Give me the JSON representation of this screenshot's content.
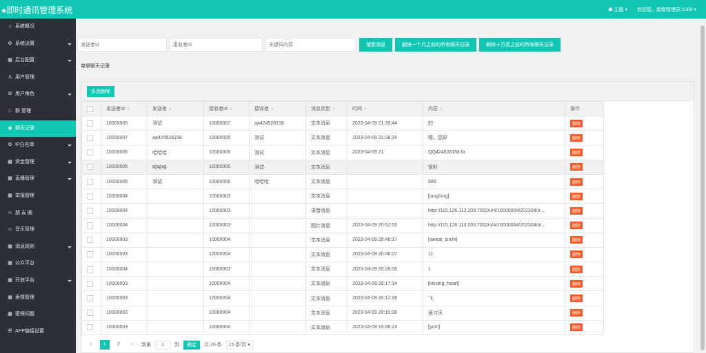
{
  "header": {
    "title": "●即时通讯管理系统",
    "theme_label": "主题",
    "welcome": "欢迎您，超级管理员:1000"
  },
  "sidebar": {
    "items": [
      {
        "label": "系统概况",
        "icon": "home-icon",
        "glyph": "⌂",
        "caret": false,
        "active": false
      },
      {
        "label": "系统设置",
        "icon": "gear-icon",
        "glyph": "⚙",
        "caret": true,
        "active": false
      },
      {
        "label": "后台配置",
        "icon": "calendar-icon",
        "glyph": "▦",
        "caret": true,
        "active": false
      },
      {
        "label": "用户管理",
        "icon": "user-icon",
        "glyph": "♙",
        "caret": false,
        "active": false
      },
      {
        "label": "用户角色",
        "icon": "gear-icon",
        "glyph": "⚙",
        "caret": true,
        "active": false
      },
      {
        "label": "群 管理",
        "icon": "group-icon",
        "glyph": "♘",
        "caret": false,
        "active": false
      },
      {
        "label": "聊天记录",
        "icon": "eye-icon",
        "glyph": "◉",
        "caret": false,
        "active": true
      },
      {
        "label": "IP白名单",
        "icon": "gear-icon",
        "glyph": "⚙",
        "caret": true,
        "active": false
      },
      {
        "label": "资金管理",
        "icon": "calendar-icon",
        "glyph": "▦",
        "caret": true,
        "active": false
      },
      {
        "label": "直播管理",
        "icon": "calendar-icon",
        "glyph": "▦",
        "caret": true,
        "active": false
      },
      {
        "label": "举报管理",
        "icon": "calendar-icon",
        "glyph": "▦",
        "caret": false,
        "active": false
      },
      {
        "label": "朋 友 圈",
        "icon": "smile-icon",
        "glyph": "☺",
        "caret": false,
        "active": false
      },
      {
        "label": "音乐管理",
        "icon": "smile-icon",
        "glyph": "☺",
        "caret": false,
        "active": false
      },
      {
        "label": "消息规则",
        "icon": "calendar-icon",
        "glyph": "▦",
        "caret": true,
        "active": false
      },
      {
        "label": "公众平台",
        "icon": "calendar-icon",
        "glyph": "▦",
        "caret": false,
        "active": false
      },
      {
        "label": "开放平台",
        "icon": "calendar-icon",
        "glyph": "▦",
        "caret": true,
        "active": false
      },
      {
        "label": "表情管理",
        "icon": "calendar-icon",
        "glyph": "▦",
        "caret": false,
        "active": false
      },
      {
        "label": "密保问题",
        "icon": "calendar-icon",
        "glyph": "▦",
        "caret": false,
        "active": false
      },
      {
        "label": "APP链接设置",
        "icon": "layers-icon",
        "glyph": "☰",
        "caret": false,
        "active": false
      }
    ]
  },
  "filters": {
    "sender_placeholder": "发送者Id",
    "receiver_placeholder": "接收者Id",
    "keyword_placeholder": "关键词内容",
    "search_label": "搜索消息",
    "delete_month_label": "删除一个月之前的所有聊天记录",
    "delete_100k_label": "删除十万条之前的所有聊天记录"
  },
  "section_title": "单聊聊天记录",
  "table": {
    "multi_delete_label": "多选删除",
    "columns": [
      "发送者Id",
      "发送者",
      "接收者Id",
      "接收者",
      "消息类型",
      "时间",
      "内容",
      "操作"
    ],
    "delete_label": "删除",
    "rows": [
      {
        "sender_id": "10000005",
        "sender": "测试",
        "receiver_id": "10000007",
        "receiver": "aa424528158",
        "type": "文本消息",
        "time": "2023-04-09 21:39:44",
        "content": "的"
      },
      {
        "sender_id": "10000007",
        "sender": "aa424528158",
        "receiver_id": "10000005",
        "receiver": "测试",
        "type": "文本消息",
        "time": "2023-04-09 21:38:34",
        "content": "嗯，您好"
      },
      {
        "sender_id": "10000006",
        "sender": "哈哈哈",
        "receiver_id": "10000005",
        "receiver": "测试",
        "type": "文本消息",
        "time": "2023-04-09 21",
        "content": "QQ424528158 fa"
      },
      {
        "sender_id": "10000006",
        "sender": "哈哈哈",
        "receiver_id": "10000005",
        "receiver": "测试",
        "type": "文本消息",
        "time": "",
        "content": "很好"
      },
      {
        "sender_id": "10000005",
        "sender": "测试",
        "receiver_id": "10000006",
        "receiver": "哈哈哈",
        "type": "文本消息",
        "time": "",
        "content": "666"
      },
      {
        "sender_id": "10000004",
        "sender": "",
        "receiver_id": "10000003",
        "receiver": "",
        "type": "文本消息",
        "time": "",
        "content": "[laughing]"
      },
      {
        "sender_id": "10000004",
        "sender": "",
        "receiver_id": "10000003",
        "receiver": "",
        "type": "语音消息",
        "time": "",
        "content": "http://115.126.113.203:7002/u/4/10000004/202304/o..."
      },
      {
        "sender_id": "10000004",
        "sender": "",
        "receiver_id": "10000003",
        "receiver": "",
        "type": "图片消息",
        "time": "2023-04-09 20:52:55",
        "content": "http://115.126.113.203:7002/u/4/10000004/202304/o/..."
      },
      {
        "sender_id": "10000003",
        "sender": "",
        "receiver_id": "10000004",
        "receiver": "",
        "type": "文本消息",
        "time": "2023-04-09 20:46:17",
        "content": "[sweat_smile]"
      },
      {
        "sender_id": "10000003",
        "sender": "",
        "receiver_id": "10000004",
        "receiver": "",
        "type": "文本消息",
        "time": "2023-04-09 20:46:07",
        "content": "11"
      },
      {
        "sender_id": "10000004",
        "sender": "",
        "receiver_id": "10000003",
        "receiver": "",
        "type": "文本消息",
        "time": "2023-04-09 20:26:06",
        "content": "1"
      },
      {
        "sender_id": "10000003",
        "sender": "",
        "receiver_id": "10000004",
        "receiver": "",
        "type": "文本消息",
        "time": "2023-04-09 20:17:14",
        "content": "[kissing_heart]"
      },
      {
        "sender_id": "10000003",
        "sender": "",
        "receiver_id": "10000004",
        "receiver": "",
        "type": "文本消息",
        "time": "2023-04-09 20:12:28",
        "content": "飞"
      },
      {
        "sender_id": "10000003",
        "sender": "",
        "receiver_id": "10000004",
        "receiver": "",
        "type": "文本消息",
        "time": "2023-04-09 20:10:08",
        "content": "很讨厌"
      },
      {
        "sender_id": "10000003",
        "sender": "",
        "receiver_id": "10000004",
        "receiver": "",
        "type": "文本消息",
        "time": "2023-04-09 19:46:23",
        "content": "[yum]"
      }
    ]
  },
  "pager": {
    "prev": "‹",
    "pages": [
      "1",
      "2"
    ],
    "next": "›",
    "goto_label": "到第",
    "goto_value": "1",
    "page_unit": "页",
    "confirm_label": "确定",
    "total_label": "共 20 条",
    "page_size": "15 条/页"
  },
  "colors": {
    "accent": "#11c7b4",
    "sidebar_bg": "#2b3038",
    "danger": "#ff5722"
  }
}
